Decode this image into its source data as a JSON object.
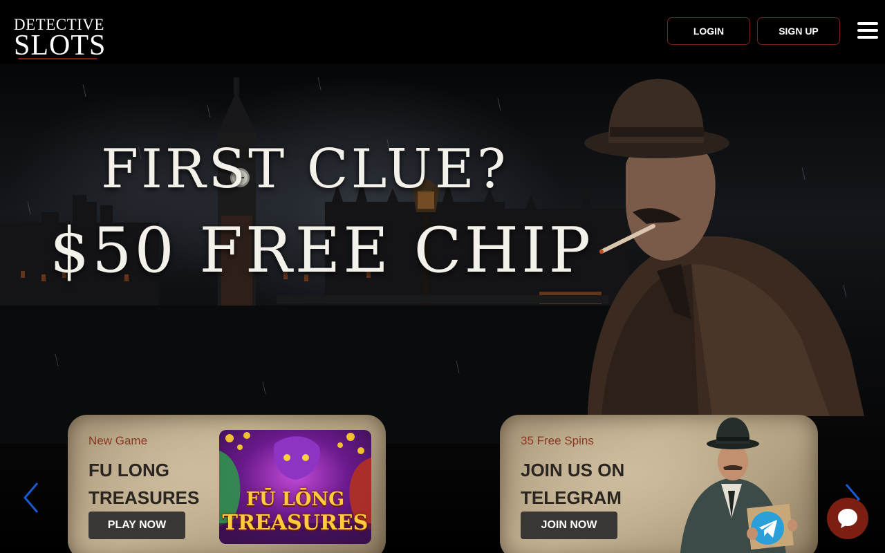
{
  "header": {
    "logo_line1": "DETECTIVE",
    "logo_line2": "SLOTS",
    "login_label": "LOGIN",
    "signup_label": "SIGN UP"
  },
  "hero": {
    "headline_line1": "FIRST CLUE?",
    "headline_line2": "$50 FREE CHIP"
  },
  "promos": [
    {
      "eyebrow": "New Game",
      "title": "FU LONG TREASURES",
      "button": "PLAY NOW",
      "art_line1": "FŪ LŌNG",
      "art_line2": "TREASURES"
    },
    {
      "eyebrow": "35 Free Spins",
      "title": "JOIN US ON TELEGRAM",
      "button": "JOIN NOW"
    }
  ],
  "colors": {
    "accent_border": "#7a2418",
    "eyebrow": "#8a3820",
    "chat_bubble": "#7c1f12",
    "arrow": "#1a5ad0"
  },
  "icons": [
    "magnifier-icon",
    "menu-icon",
    "chevron-left-icon",
    "chevron-right-icon",
    "chat-icon",
    "telegram-icon"
  ]
}
